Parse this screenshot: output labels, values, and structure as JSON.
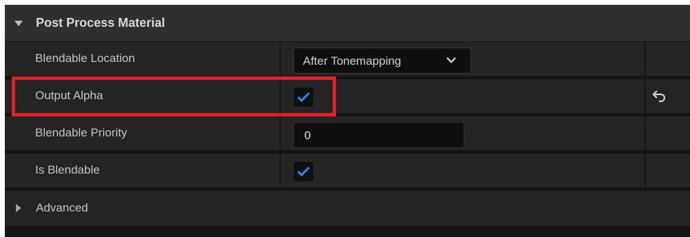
{
  "section": {
    "title": "Post Process Material",
    "collapse_icon": "triangle-down-icon"
  },
  "rows": [
    {
      "label": "Blendable Location",
      "control": "dropdown",
      "value": "After Tonemapping",
      "icon": "chevron-down-icon"
    },
    {
      "label": "Output Alpha",
      "control": "checkbox",
      "checked": true,
      "reset_icon": "reset-arrow-icon",
      "highlighted": true
    },
    {
      "label": "Blendable Priority",
      "control": "number",
      "value": "0"
    },
    {
      "label": "Is Blendable",
      "control": "checkbox",
      "checked": true
    }
  ],
  "advanced": {
    "label": "Advanced",
    "expand_icon": "triangle-right-icon"
  },
  "colors": {
    "check_accent": "#1f8fff",
    "highlight": "#e0202a",
    "panel_bg": "#151515",
    "row_bg": "#242424",
    "header_bg": "#2f2f2f"
  }
}
